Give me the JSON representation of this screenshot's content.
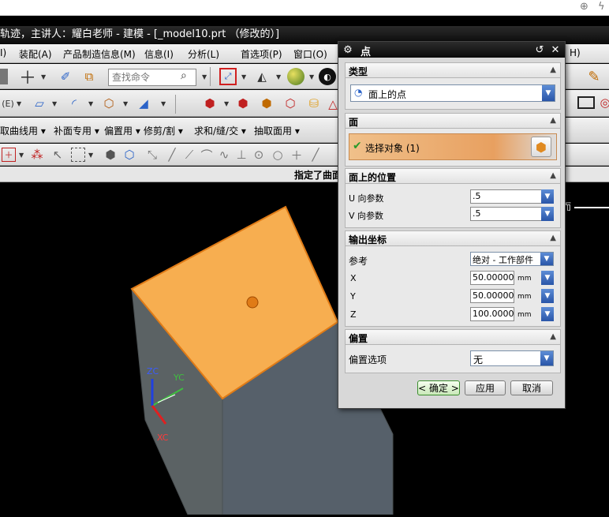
{
  "window": {
    "title": "轨迹，主讲人：耀白老师 - 建模 - [_model10.prt （修改的）]"
  },
  "menu": {
    "items": [
      "I)",
      "装配(A)",
      "产品制造信息(M)",
      "信息(I)",
      "分析(L)",
      "首选项(P)",
      "窗口(O)",
      "H)"
    ]
  },
  "toolbar": {
    "search_placeholder": "查找命令",
    "row3_labels": [
      "取曲线用 ▾",
      "补面专用 ▾",
      "偏置用 ▾",
      "修剪/割 ▾",
      "求和/缝/交 ▾",
      "抽取面用 ▾"
    ]
  },
  "status": {
    "prompt": "指定了曲面"
  },
  "viewport": {
    "background": "#000000",
    "cube_top_color": "#f7ae50",
    "cube_side_color": "#5b6264",
    "point_marker_color": "#e07b16",
    "axis_labels": {
      "zc": "ZC",
      "yc": "YC",
      "xc": "XC"
    },
    "right_text": "而"
  },
  "dialog": {
    "title": "点",
    "sections": {
      "type": {
        "label": "类型",
        "value": "面上的点"
      },
      "face": {
        "label": "面",
        "selection": "选择对象 (1)"
      },
      "position": {
        "label": "面上的位置",
        "u_label": "U 向参数",
        "u_value": ".5",
        "v_label": "V 向参数",
        "v_value": ".5"
      },
      "output": {
        "label": "输出坐标",
        "ref_label": "参考",
        "ref_value": "绝对 - 工作部件",
        "x_label": "X",
        "x_value": "50.000000",
        "y_label": "Y",
        "y_value": "50.000000",
        "z_label": "Z",
        "z_value": "100.00000",
        "unit": "mm"
      },
      "offset": {
        "label": "偏置",
        "option_label": "偏置选项",
        "option_value": "无"
      }
    },
    "buttons": {
      "ok": "< 确定 >",
      "apply": "应用",
      "cancel": "取消"
    },
    "accent_color": "#e8a060"
  }
}
